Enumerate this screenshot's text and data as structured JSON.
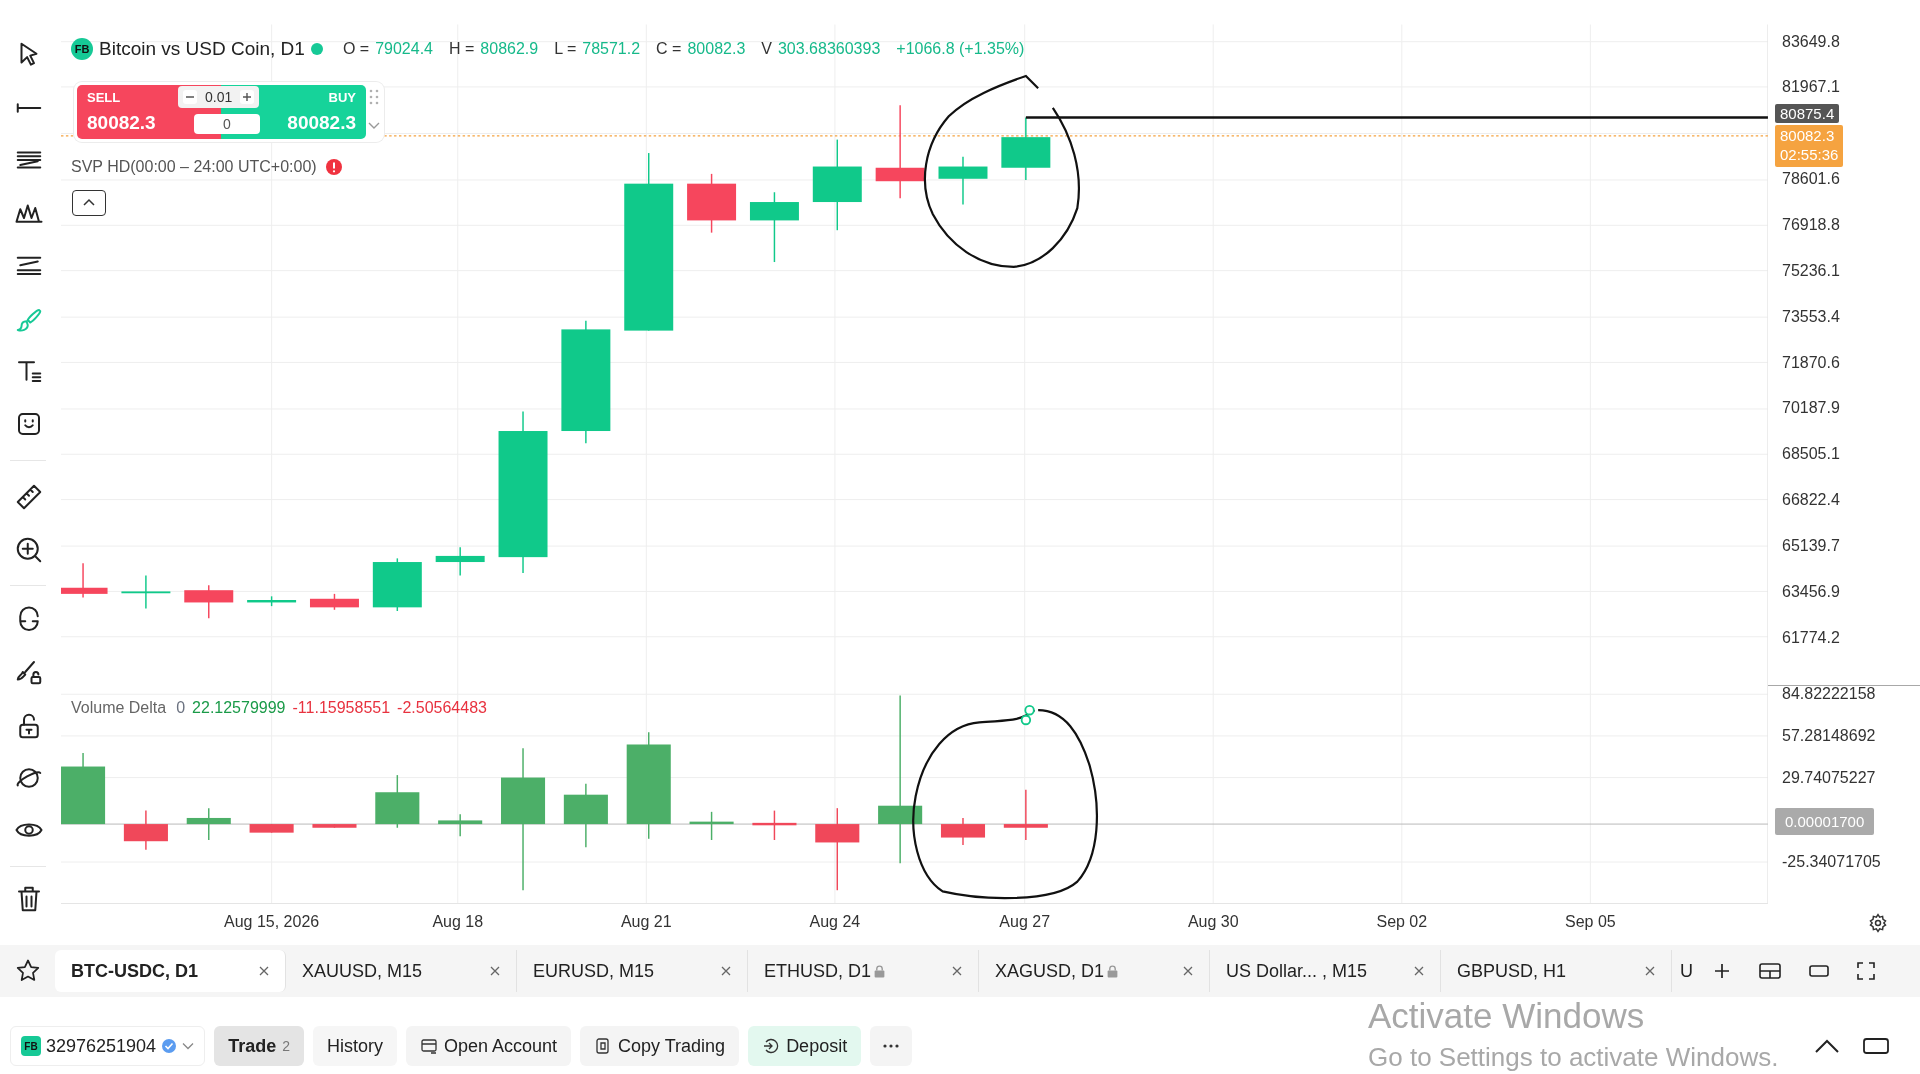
{
  "toolbar": {
    "tools": [
      {
        "kind": "cursor",
        "selected": false
      },
      {
        "kind": "line",
        "selected": false
      },
      {
        "kind": "fib",
        "selected": false
      },
      {
        "kind": "pattern",
        "selected": false
      },
      {
        "kind": "channel",
        "selected": false
      },
      {
        "kind": "brush",
        "selected": true
      },
      {
        "kind": "text",
        "selected": false
      },
      {
        "kind": "emoji",
        "selected": false
      },
      {
        "kind": "divider"
      },
      {
        "kind": "ruler",
        "selected": false
      },
      {
        "kind": "zoom",
        "selected": false
      },
      {
        "kind": "divider"
      },
      {
        "kind": "magnet",
        "selected": false
      },
      {
        "kind": "lock-drawing",
        "selected": false
      },
      {
        "kind": "lock",
        "selected": false
      },
      {
        "kind": "planet",
        "selected": false
      },
      {
        "kind": "eye",
        "selected": false
      },
      {
        "kind": "divider"
      },
      {
        "kind": "trash",
        "selected": false
      }
    ]
  },
  "header": {
    "badge": "FB",
    "title": "Bitcoin vs USD Coin, D1",
    "live": true,
    "ohlc": [
      {
        "label": "O =",
        "value": "79024.4"
      },
      {
        "label": "H =",
        "value": "80862.9"
      },
      {
        "label": "L =",
        "value": "78571.2"
      },
      {
        "label": "C =",
        "value": "80082.3"
      },
      {
        "label": "V",
        "value": "303.68360393"
      }
    ],
    "change": "+1066.8 (+1.35%)"
  },
  "trade_widget": {
    "sell_label": "SELL",
    "sell_price": "80082.3",
    "quantity": "0.01",
    "spread": "0",
    "buy_label": "BUY",
    "buy_price": "80082.3"
  },
  "indicator": {
    "label": "SVP HD(00:00 – 24:00 UTC+0:00)",
    "alert": true
  },
  "price_axis": {
    "ticks": [
      "83649.8",
      "81967.1",
      "78601.6",
      "76918.8",
      "75236.1",
      "73553.4",
      "71870.6",
      "70187.9",
      "68505.1",
      "66822.4",
      "65139.7",
      "63456.9",
      "61774.2"
    ],
    "line_marker": "80875.4",
    "current_price": "80082.3",
    "countdown": "02:55:36"
  },
  "volume_delta": {
    "label": "Volume Delta",
    "values": [
      {
        "text": "0",
        "color": "#6b7280"
      },
      {
        "text": "22.12579999",
        "color": "#1a9a48"
      },
      {
        "text": "-11.15958551",
        "color": "#e8323f"
      },
      {
        "text": "-2.50564483",
        "color": "#e8323f"
      }
    ],
    "ticks": [
      "84.82222158",
      "57.28148692",
      "29.74075227",
      "-25.34071705"
    ],
    "marker": "0.00001700"
  },
  "time_axis": {
    "labels": [
      "Aug 15, 2026",
      "Aug 18",
      "Aug 21",
      "Aug 24",
      "Aug 27",
      "Aug 30",
      "Sep 02",
      "Sep 05"
    ]
  },
  "tabs": [
    {
      "label": "BTC-USDC, D1",
      "selected": true,
      "locked": false
    },
    {
      "label": "XAUUSD, M15",
      "selected": false,
      "locked": false
    },
    {
      "label": "EURUSD, M15",
      "selected": false,
      "locked": false
    },
    {
      "label": "ETHUSD, D1",
      "selected": false,
      "locked": true
    },
    {
      "label": "XAGUSD, D1",
      "selected": false,
      "locked": true
    },
    {
      "label": "US Dollar... , M15",
      "selected": false,
      "locked": false
    },
    {
      "label": "GBPUSD, H1",
      "selected": false,
      "locked": false
    }
  ],
  "partial_tab": "U",
  "bottom_bar": {
    "account_badge": "FB",
    "account": "32976251904",
    "verified": true,
    "buttons": [
      {
        "kind": "nav",
        "label": "Trade",
        "count": "2",
        "selected": true
      },
      {
        "kind": "nav",
        "label": "History",
        "selected": false
      },
      {
        "kind": "account",
        "label": "Open Account",
        "selected": false
      },
      {
        "kind": "copy",
        "label": "Copy Trading",
        "selected": false
      },
      {
        "kind": "deposit",
        "label": "Deposit",
        "selected": false
      }
    ]
  },
  "os_notice": {
    "title": "Activate Windows",
    "text": "Go to Settings to activate Windows."
  }
}
